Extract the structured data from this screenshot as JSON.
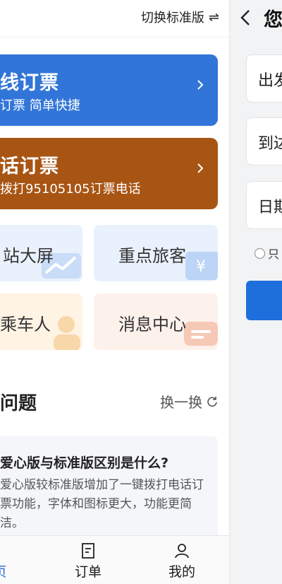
{
  "header": {
    "switch_label": "切换标准版",
    "switch_icon": "swap-arrows-icon"
  },
  "cards": {
    "online": {
      "title": "线订票",
      "subtitle": "订票 简单快捷",
      "color": "#3275d8"
    },
    "phone": {
      "title": "话订票",
      "subtitle": "拨打95105105订票电话",
      "color": "#a85514"
    }
  },
  "tiles": [
    {
      "label": "站大屏"
    },
    {
      "label": "重点旅客"
    },
    {
      "label": "乘车人"
    },
    {
      "label": "消息中心"
    }
  ],
  "faq": {
    "title": "问题",
    "refresh_label": "换一换",
    "question": "爱心版与标准版区别是什么?",
    "answer": "爱心版较标准版增加了一键拨打电话订票功能，字体和图标更大，功能更简洁。"
  },
  "tabbar": {
    "home": "页",
    "orders": "订单",
    "mine": "我的",
    "active_color": "#2e6fd8"
  },
  "right_panel": {
    "greeting": "您",
    "fields": [
      "出发",
      "到达",
      "日期"
    ],
    "only_option": "只",
    "button_color": "#1e6fdc"
  }
}
